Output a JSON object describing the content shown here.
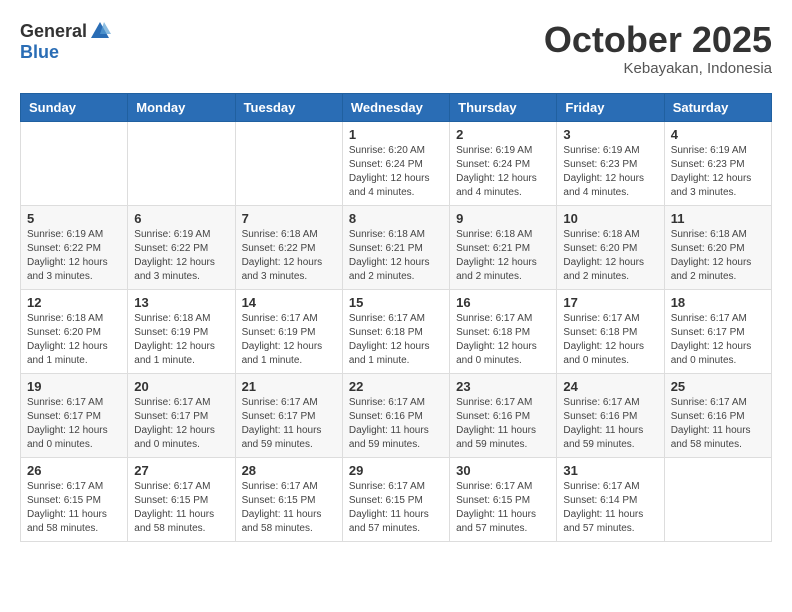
{
  "logo": {
    "general": "General",
    "blue": "Blue"
  },
  "header": {
    "month": "October 2025",
    "location": "Kebayakan, Indonesia"
  },
  "weekdays": [
    "Sunday",
    "Monday",
    "Tuesday",
    "Wednesday",
    "Thursday",
    "Friday",
    "Saturday"
  ],
  "weeks": [
    [
      {
        "day": "",
        "info": ""
      },
      {
        "day": "",
        "info": ""
      },
      {
        "day": "",
        "info": ""
      },
      {
        "day": "1",
        "info": "Sunrise: 6:20 AM\nSunset: 6:24 PM\nDaylight: 12 hours\nand 4 minutes."
      },
      {
        "day": "2",
        "info": "Sunrise: 6:19 AM\nSunset: 6:24 PM\nDaylight: 12 hours\nand 4 minutes."
      },
      {
        "day": "3",
        "info": "Sunrise: 6:19 AM\nSunset: 6:23 PM\nDaylight: 12 hours\nand 4 minutes."
      },
      {
        "day": "4",
        "info": "Sunrise: 6:19 AM\nSunset: 6:23 PM\nDaylight: 12 hours\nand 3 minutes."
      }
    ],
    [
      {
        "day": "5",
        "info": "Sunrise: 6:19 AM\nSunset: 6:22 PM\nDaylight: 12 hours\nand 3 minutes."
      },
      {
        "day": "6",
        "info": "Sunrise: 6:19 AM\nSunset: 6:22 PM\nDaylight: 12 hours\nand 3 minutes."
      },
      {
        "day": "7",
        "info": "Sunrise: 6:18 AM\nSunset: 6:22 PM\nDaylight: 12 hours\nand 3 minutes."
      },
      {
        "day": "8",
        "info": "Sunrise: 6:18 AM\nSunset: 6:21 PM\nDaylight: 12 hours\nand 2 minutes."
      },
      {
        "day": "9",
        "info": "Sunrise: 6:18 AM\nSunset: 6:21 PM\nDaylight: 12 hours\nand 2 minutes."
      },
      {
        "day": "10",
        "info": "Sunrise: 6:18 AM\nSunset: 6:20 PM\nDaylight: 12 hours\nand 2 minutes."
      },
      {
        "day": "11",
        "info": "Sunrise: 6:18 AM\nSunset: 6:20 PM\nDaylight: 12 hours\nand 2 minutes."
      }
    ],
    [
      {
        "day": "12",
        "info": "Sunrise: 6:18 AM\nSunset: 6:20 PM\nDaylight: 12 hours\nand 1 minute."
      },
      {
        "day": "13",
        "info": "Sunrise: 6:18 AM\nSunset: 6:19 PM\nDaylight: 12 hours\nand 1 minute."
      },
      {
        "day": "14",
        "info": "Sunrise: 6:17 AM\nSunset: 6:19 PM\nDaylight: 12 hours\nand 1 minute."
      },
      {
        "day": "15",
        "info": "Sunrise: 6:17 AM\nSunset: 6:18 PM\nDaylight: 12 hours\nand 1 minute."
      },
      {
        "day": "16",
        "info": "Sunrise: 6:17 AM\nSunset: 6:18 PM\nDaylight: 12 hours\nand 0 minutes."
      },
      {
        "day": "17",
        "info": "Sunrise: 6:17 AM\nSunset: 6:18 PM\nDaylight: 12 hours\nand 0 minutes."
      },
      {
        "day": "18",
        "info": "Sunrise: 6:17 AM\nSunset: 6:17 PM\nDaylight: 12 hours\nand 0 minutes."
      }
    ],
    [
      {
        "day": "19",
        "info": "Sunrise: 6:17 AM\nSunset: 6:17 PM\nDaylight: 12 hours\nand 0 minutes."
      },
      {
        "day": "20",
        "info": "Sunrise: 6:17 AM\nSunset: 6:17 PM\nDaylight: 12 hours\nand 0 minutes."
      },
      {
        "day": "21",
        "info": "Sunrise: 6:17 AM\nSunset: 6:17 PM\nDaylight: 11 hours\nand 59 minutes."
      },
      {
        "day": "22",
        "info": "Sunrise: 6:17 AM\nSunset: 6:16 PM\nDaylight: 11 hours\nand 59 minutes."
      },
      {
        "day": "23",
        "info": "Sunrise: 6:17 AM\nSunset: 6:16 PM\nDaylight: 11 hours\nand 59 minutes."
      },
      {
        "day": "24",
        "info": "Sunrise: 6:17 AM\nSunset: 6:16 PM\nDaylight: 11 hours\nand 59 minutes."
      },
      {
        "day": "25",
        "info": "Sunrise: 6:17 AM\nSunset: 6:16 PM\nDaylight: 11 hours\nand 58 minutes."
      }
    ],
    [
      {
        "day": "26",
        "info": "Sunrise: 6:17 AM\nSunset: 6:15 PM\nDaylight: 11 hours\nand 58 minutes."
      },
      {
        "day": "27",
        "info": "Sunrise: 6:17 AM\nSunset: 6:15 PM\nDaylight: 11 hours\nand 58 minutes."
      },
      {
        "day": "28",
        "info": "Sunrise: 6:17 AM\nSunset: 6:15 PM\nDaylight: 11 hours\nand 58 minutes."
      },
      {
        "day": "29",
        "info": "Sunrise: 6:17 AM\nSunset: 6:15 PM\nDaylight: 11 hours\nand 57 minutes."
      },
      {
        "day": "30",
        "info": "Sunrise: 6:17 AM\nSunset: 6:15 PM\nDaylight: 11 hours\nand 57 minutes."
      },
      {
        "day": "31",
        "info": "Sunrise: 6:17 AM\nSunset: 6:14 PM\nDaylight: 11 hours\nand 57 minutes."
      },
      {
        "day": "",
        "info": ""
      }
    ]
  ]
}
